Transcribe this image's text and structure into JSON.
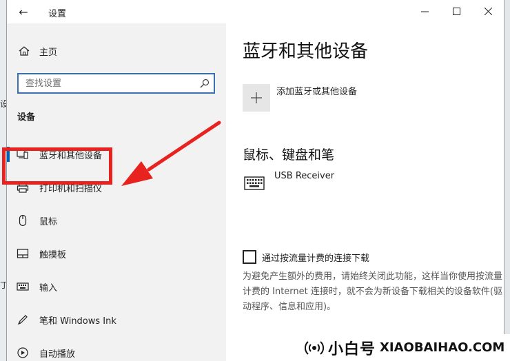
{
  "window": {
    "title": "设置",
    "back_glyph": "←",
    "controls": [
      "minimize",
      "maximize",
      "close"
    ]
  },
  "sidebar": {
    "home_label": "主页",
    "search_placeholder": "查找设置",
    "section_title": "设备",
    "items": [
      {
        "label": "蓝牙和其他设备",
        "icon": "bluetooth-devices-icon",
        "selected": true
      },
      {
        "label": "打印机和扫描仪",
        "icon": "printer-icon",
        "selected": false
      },
      {
        "label": "鼠标",
        "icon": "mouse-icon",
        "selected": false
      },
      {
        "label": "触摸板",
        "icon": "touchpad-icon",
        "selected": false
      },
      {
        "label": "输入",
        "icon": "keyboard-icon",
        "selected": false
      },
      {
        "label": "笔和 Windows Ink",
        "icon": "pen-icon",
        "selected": false
      },
      {
        "label": "自动播放",
        "icon": "autoplay-icon",
        "selected": false
      }
    ]
  },
  "main": {
    "heading": "蓝牙和其他设备",
    "add_device_label": "添加蓝牙或其他设备",
    "section_mouse_keyboard_pen": "鼠标、键盘和笔",
    "devices": [
      {
        "name": "USB Receiver",
        "icon": "keyboard-icon"
      }
    ],
    "metered_checkbox_label": "通过按流量计费的连接下载",
    "metered_checked": false,
    "metered_description": "为避免产生额外的费用，请始终关闭此功能，这样当你使用按流量计费的 Internet 连接时，就不会为新设备下载相关的设备软件(驱动程序、信息和应用)。"
  },
  "background_cut_text": [
    "设",
    "丁"
  ],
  "brand": {
    "cn": "小白号",
    "en": "XIAOBAIHAO.COM"
  },
  "colors": {
    "accent": "#0063b1",
    "annotation_red": "#e8231f",
    "sidebar_bg": "#f2f2f2"
  }
}
